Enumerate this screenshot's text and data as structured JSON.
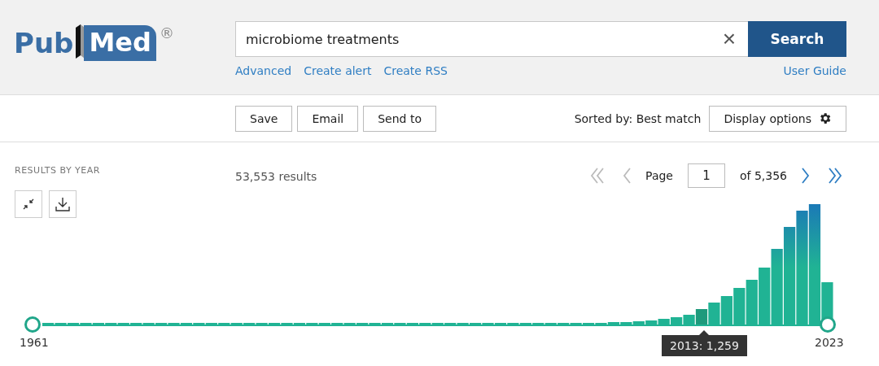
{
  "logo": {
    "text_1": "Pub",
    "text_2": "Med",
    "mark": "®"
  },
  "search": {
    "value": "microbiome treatments",
    "clear": "×",
    "button": "Search"
  },
  "links": [
    "Advanced",
    "Create alert",
    "Create RSS"
  ],
  "user_guide": "User Guide",
  "actions": [
    "Save",
    "Email",
    "Send to"
  ],
  "sort": "Sorted by: Best match",
  "display_options": "Display options",
  "results_by_year": "RESULTS BY YEAR",
  "results_count": "53,553 results",
  "pagination": {
    "first_disabled": true,
    "prev_disabled": true,
    "page_label": "Page",
    "page_value": "1",
    "of": "of 5,356",
    "next_disabled": false,
    "last_disabled": false
  },
  "timeline": {
    "start": "1961",
    "end": "2023",
    "tooltip": "2013: 1,259"
  }
}
